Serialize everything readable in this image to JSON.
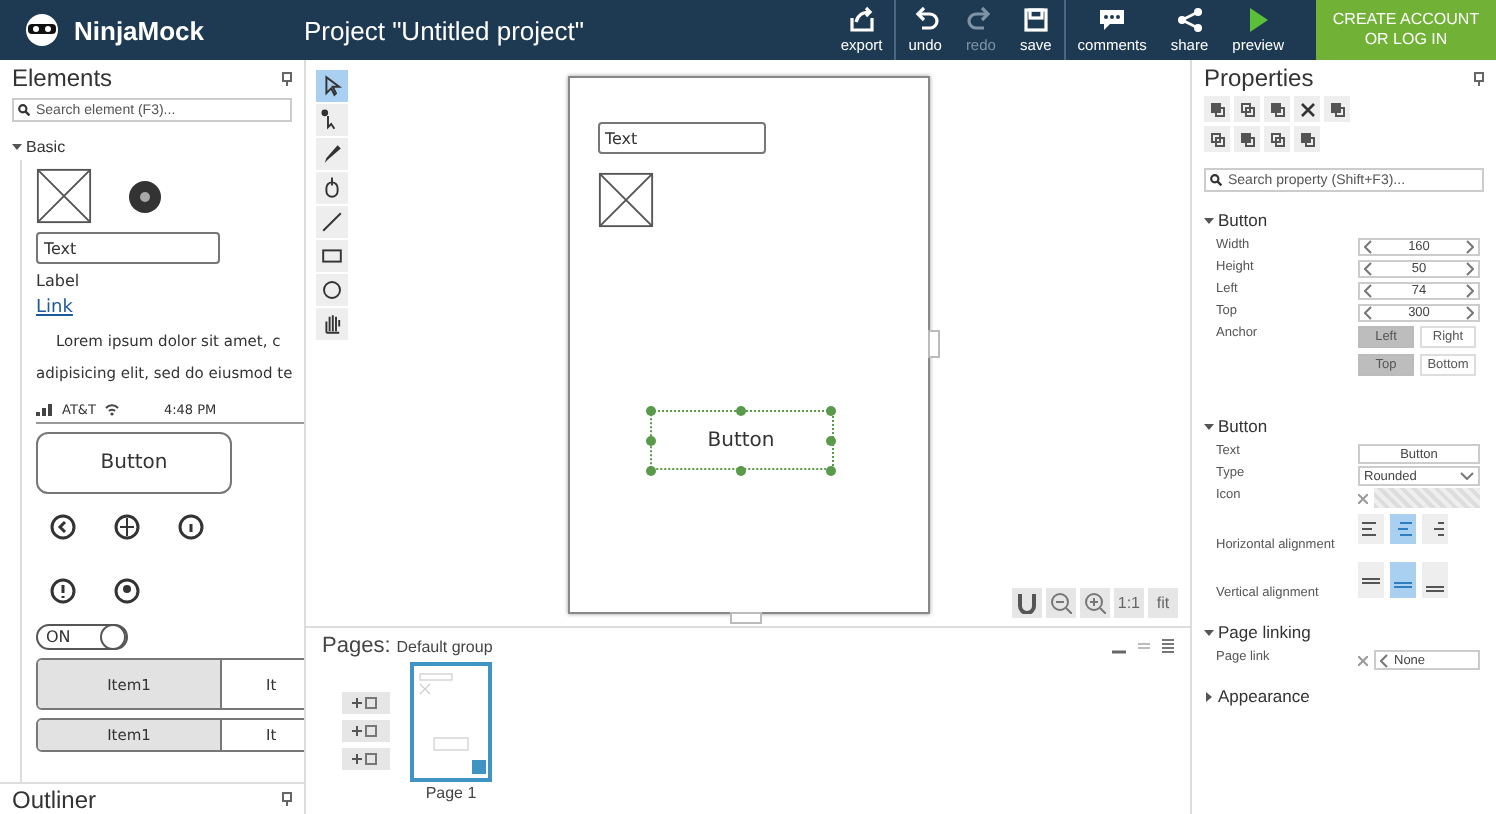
{
  "header": {
    "logo": "NinjaMock",
    "project_title": "Project \"Untitled project\"",
    "actions": [
      {
        "kind": "export",
        "label": "export",
        "disabled": false
      },
      {
        "kind": "undo",
        "label": "undo",
        "disabled": false
      },
      {
        "kind": "redo",
        "label": "redo",
        "disabled": true
      },
      {
        "kind": "save",
        "label": "save",
        "disabled": false
      },
      {
        "kind": "comments",
        "label": "comments",
        "disabled": false
      },
      {
        "kind": "share",
        "label": "share",
        "disabled": false
      },
      {
        "kind": "preview",
        "label": "preview",
        "disabled": false
      }
    ],
    "account_button": "CREATE ACCOUNT OR LOG IN"
  },
  "elements": {
    "title": "Elements",
    "search": {
      "placeholder": "Search element (F3)..."
    },
    "group": {
      "label": "Basic",
      "expanded": true
    },
    "palette": [
      {
        "kind": "image-badge"
      },
      {
        "kind": "textfield",
        "text": "Text"
      },
      {
        "kind": "label",
        "text": "Label"
      },
      {
        "kind": "link",
        "text": "Link"
      },
      {
        "kind": "paragraph",
        "lines": [
          "Lorem ipsum dolor sit amet, c",
          "adipisicing elit, sed do eiusmod te"
        ]
      },
      {
        "kind": "statusbar",
        "carrier": "AT&T",
        "time": "4:48 PM"
      },
      {
        "kind": "button",
        "text": "Button"
      },
      {
        "kind": "icons"
      },
      {
        "kind": "toggle",
        "text": "ON",
        "on": true
      },
      {
        "kind": "segmented",
        "items": [
          "Item1",
          "It"
        ]
      },
      {
        "kind": "segmented",
        "items": [
          "Item1",
          "It"
        ]
      }
    ],
    "outliner": "Outliner"
  },
  "tools": [
    {
      "kind": "select",
      "selected": true
    },
    {
      "kind": "direct",
      "selected": false
    },
    {
      "kind": "pen",
      "selected": false
    },
    {
      "kind": "mouse",
      "selected": false
    },
    {
      "kind": "line",
      "selected": false
    },
    {
      "kind": "rect",
      "selected": false
    },
    {
      "kind": "ellipse",
      "selected": false
    },
    {
      "kind": "hand",
      "selected": false
    }
  ],
  "canvas": {
    "items": [
      {
        "kind": "textfield",
        "text": "Text",
        "selected": false
      },
      {
        "kind": "image",
        "selected": false
      },
      {
        "kind": "button",
        "text": "Button",
        "selected": true
      }
    ],
    "zoom_controls": [
      {
        "kind": "magnet"
      },
      {
        "kind": "zoom-out"
      },
      {
        "kind": "zoom-in"
      },
      {
        "kind": "text",
        "label": "1:1"
      },
      {
        "kind": "text",
        "label": "fit"
      }
    ]
  },
  "pages": {
    "title": "Pages:",
    "group": "Default group",
    "pages": [
      {
        "label": "Page 1",
        "selected": true
      }
    ]
  },
  "properties": {
    "title": "Properties",
    "search": {
      "placeholder": "Search property (Shift+F3)..."
    },
    "sections": [
      {
        "title": "Button",
        "expanded": true,
        "rows": [
          {
            "kind": "stepper",
            "label": "Width",
            "value": "160"
          },
          {
            "kind": "stepper",
            "label": "Height",
            "value": "50"
          },
          {
            "kind": "stepper",
            "label": "Left",
            "value": "74"
          },
          {
            "kind": "stepper",
            "label": "Top",
            "value": "300"
          },
          {
            "kind": "toggles",
            "label": "Anchor",
            "groups": [
              [
                {
                  "label": "Left",
                  "selected": true
                },
                {
                  "label": "Right",
                  "selected": false
                }
              ],
              [
                {
                  "label": "Top",
                  "selected": true
                },
                {
                  "label": "Bottom",
                  "selected": false
                }
              ]
            ]
          }
        ]
      },
      {
        "title": "Button",
        "expanded": true,
        "rows": [
          {
            "kind": "text",
            "label": "Text",
            "value": "Button"
          },
          {
            "kind": "select",
            "label": "Type",
            "value": "Rounded"
          },
          {
            "kind": "icon",
            "label": "Icon"
          },
          {
            "kind": "halign",
            "label": "Horizontal alignment",
            "options": [
              {
                "selected": false
              },
              {
                "selected": true
              },
              {
                "selected": false
              }
            ]
          },
          {
            "kind": "valign",
            "label": "Vertical alignment",
            "options": [
              {
                "selected": false
              },
              {
                "selected": true
              },
              {
                "selected": false
              }
            ]
          }
        ]
      },
      {
        "title": "Page linking",
        "expanded": true,
        "rows": [
          {
            "kind": "link",
            "label": "Page link",
            "value": "None"
          }
        ]
      },
      {
        "title": "Appearance",
        "expanded": false
      }
    ]
  }
}
